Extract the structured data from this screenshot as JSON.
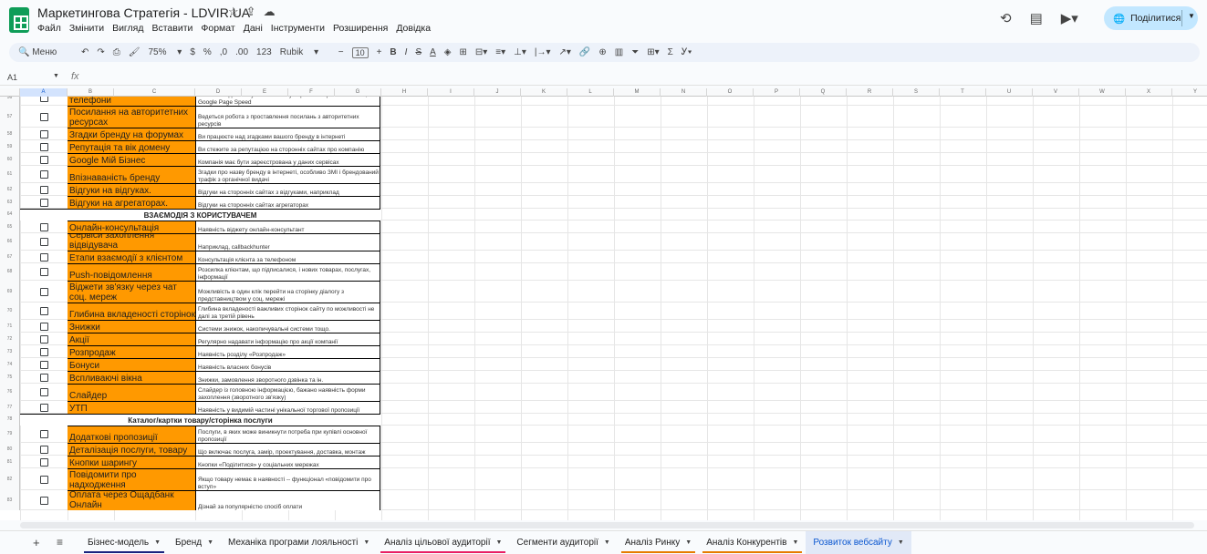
{
  "app": {
    "title": "Маркетингова Стратегія - LDVIR.UA",
    "menus": [
      "Файл",
      "Змінити",
      "Вигляд",
      "Вставити",
      "Формат",
      "Дані",
      "Інструменти",
      "Розширення",
      "Довідка"
    ],
    "share_label": "Поділитися"
  },
  "toolbar": {
    "menu_label": "Меню",
    "zoom": "75%",
    "percent": "%",
    "decimal": ",0",
    "decimal2": ".00",
    "number": "123",
    "font": "Rubik",
    "font_size": "10"
  },
  "formula": {
    "cell_ref": "A1",
    "fx": "fx"
  },
  "columns": [
    "A",
    "B",
    "C",
    "D",
    "E",
    "F",
    "G",
    "H",
    "I",
    "J",
    "K",
    "L",
    "M",
    "N",
    "O",
    "P",
    "Q",
    "R",
    "S",
    "T",
    "U",
    "V",
    "W",
    "X",
    "Y"
  ],
  "rows": [
    {
      "n": "56",
      "kind": "item",
      "name": "телефони",
      "desc": "Сайт має адаптивну або мобільну версію використання AMP, Google Page Speed"
    },
    {
      "n": "57",
      "kind": "item",
      "name": "Посилання на авторитетних ресурсах",
      "desc": "Ведеться робота з проставлення посилань з авторитетних ресурсів"
    },
    {
      "n": "58",
      "kind": "item",
      "name": "Згадки бренду на форумах",
      "desc": "Ви працюєте над згадками вашого бренду в інтернеті"
    },
    {
      "n": "59",
      "kind": "item",
      "name": "Репутація та вік домену",
      "desc": "Ви стежите за репутацією на сторонніх сайтах про компанію"
    },
    {
      "n": "60",
      "kind": "item",
      "name": "Google Мій Бізнес",
      "desc": "Компанія має бути зареєстрована у даних сервісах"
    },
    {
      "n": "61",
      "kind": "item",
      "name": "Впізнаваність бренду",
      "desc": "Згадки про назву бренду в інтернеті, особливо ЗМІ і брендований трафік з органічної видачі"
    },
    {
      "n": "62",
      "kind": "item",
      "name": "Відгуки на відгуках.",
      "desc": "Відгуки на сторонніх сайтах з відгуками, наприклад"
    },
    {
      "n": "63",
      "kind": "item",
      "name": "Відгуки на агрегаторах.",
      "desc": "Відгуки на сторонніх сайтах агрегаторах"
    },
    {
      "n": "64",
      "kind": "section",
      "name": "ВЗАЄМОДІЯ З КОРИСТУВАЧЕМ"
    },
    {
      "n": "65",
      "kind": "item",
      "name": "Онлайн-консультація",
      "desc": "Наявність віджету онлайн-консультант"
    },
    {
      "n": "66",
      "kind": "item",
      "name": "Сервіси захоплення відвідувача",
      "desc": "Наприклад, callbackhunter"
    },
    {
      "n": "67",
      "kind": "item",
      "name": "Етапи взаємодії з клієнтом",
      "desc": "Консультація клієнта за телефоном"
    },
    {
      "n": "68",
      "kind": "item",
      "name": "Push-повідомлення",
      "desc": "Розсилка клієнтам, що підписалися, і нових товарах, послугах, інформації"
    },
    {
      "n": "69",
      "kind": "item",
      "name": "Віджети зв'язку через чат соц. мереж",
      "desc": "Можливість в один клік перейти на сторінку діалогу з представництвом у соц. мережі"
    },
    {
      "n": "70",
      "kind": "item",
      "name": "Глибина вкладеності сторінок",
      "desc": "Глибина вкладеності важливих сторінок сайту по можливості не далі за третій рівень"
    },
    {
      "n": "71",
      "kind": "item",
      "name": "Знижки",
      "desc": "Системи знижок, накопичувальні системи тощо."
    },
    {
      "n": "72",
      "kind": "item",
      "name": "Акції",
      "desc": "Регулярно надавати інформацію про акції компанії"
    },
    {
      "n": "73",
      "kind": "item",
      "name": "Розпродаж",
      "desc": "Наявність розділу «Розпродаж»"
    },
    {
      "n": "74",
      "kind": "item",
      "name": "Бонуси",
      "desc": "Наявність власних бонусів"
    },
    {
      "n": "75",
      "kind": "item",
      "name": "Вспливаючі вікна",
      "desc": "Знижки, замовлення зворотного дзвінка та ін."
    },
    {
      "n": "76",
      "kind": "item",
      "name": "Слайдер",
      "desc": "Слайдер із головною інформацією, бажано наявність форми захоплення (зворотного зв'язку)"
    },
    {
      "n": "77",
      "kind": "item",
      "name": "УТП",
      "desc": "Наявність у видимій частині унікальної торгової пропозиції"
    },
    {
      "n": "78",
      "kind": "section",
      "name": "Каталог/картки товару/сторінка послуги"
    },
    {
      "n": "79",
      "kind": "item",
      "name": "Додаткові пропозиції",
      "desc": "Послуги, в яких може виникнути потреба при купівлі основної пропозиції"
    },
    {
      "n": "80",
      "kind": "item",
      "name": "Деталізація послуги, товару",
      "desc": "Що включає послуга, замір, проектування, доставка, монтаж"
    },
    {
      "n": "81",
      "kind": "item",
      "name": "Кнопки шарингу",
      "desc": "Кнопки «Поділитися» у соціальних мережах"
    },
    {
      "n": "82",
      "kind": "item",
      "name": "Повідомити про надходження",
      "desc": "Якщо товару немає в наявності -- функціонал «повідомити про вступ»"
    },
    {
      "n": "83",
      "kind": "item",
      "name": "Оплата через Ощадбанк Онлайн",
      "desc": "Дізнай за популярністю спосіб оплати"
    }
  ],
  "sheets": [
    {
      "label": "Бізнес-модель",
      "color": "#1a237e"
    },
    {
      "label": "Бренд",
      "color": ""
    },
    {
      "label": "Механіка програми лояльності",
      "color": ""
    },
    {
      "label": "Аналіз цільової аудиторії",
      "color": "#e91e63"
    },
    {
      "label": "Сегменти аудиторії",
      "color": ""
    },
    {
      "label": "Аналіз Ринку",
      "color": "#e67c00"
    },
    {
      "label": "Аналіз Конкурентів",
      "color": "#e67c00"
    },
    {
      "label": "Розвиток вебсайту",
      "color": ""
    }
  ],
  "active_sheet": 7,
  "colors": {
    "accent": "#0b57d0",
    "orange": "#ff9900",
    "share_bg": "#c2e7ff"
  }
}
